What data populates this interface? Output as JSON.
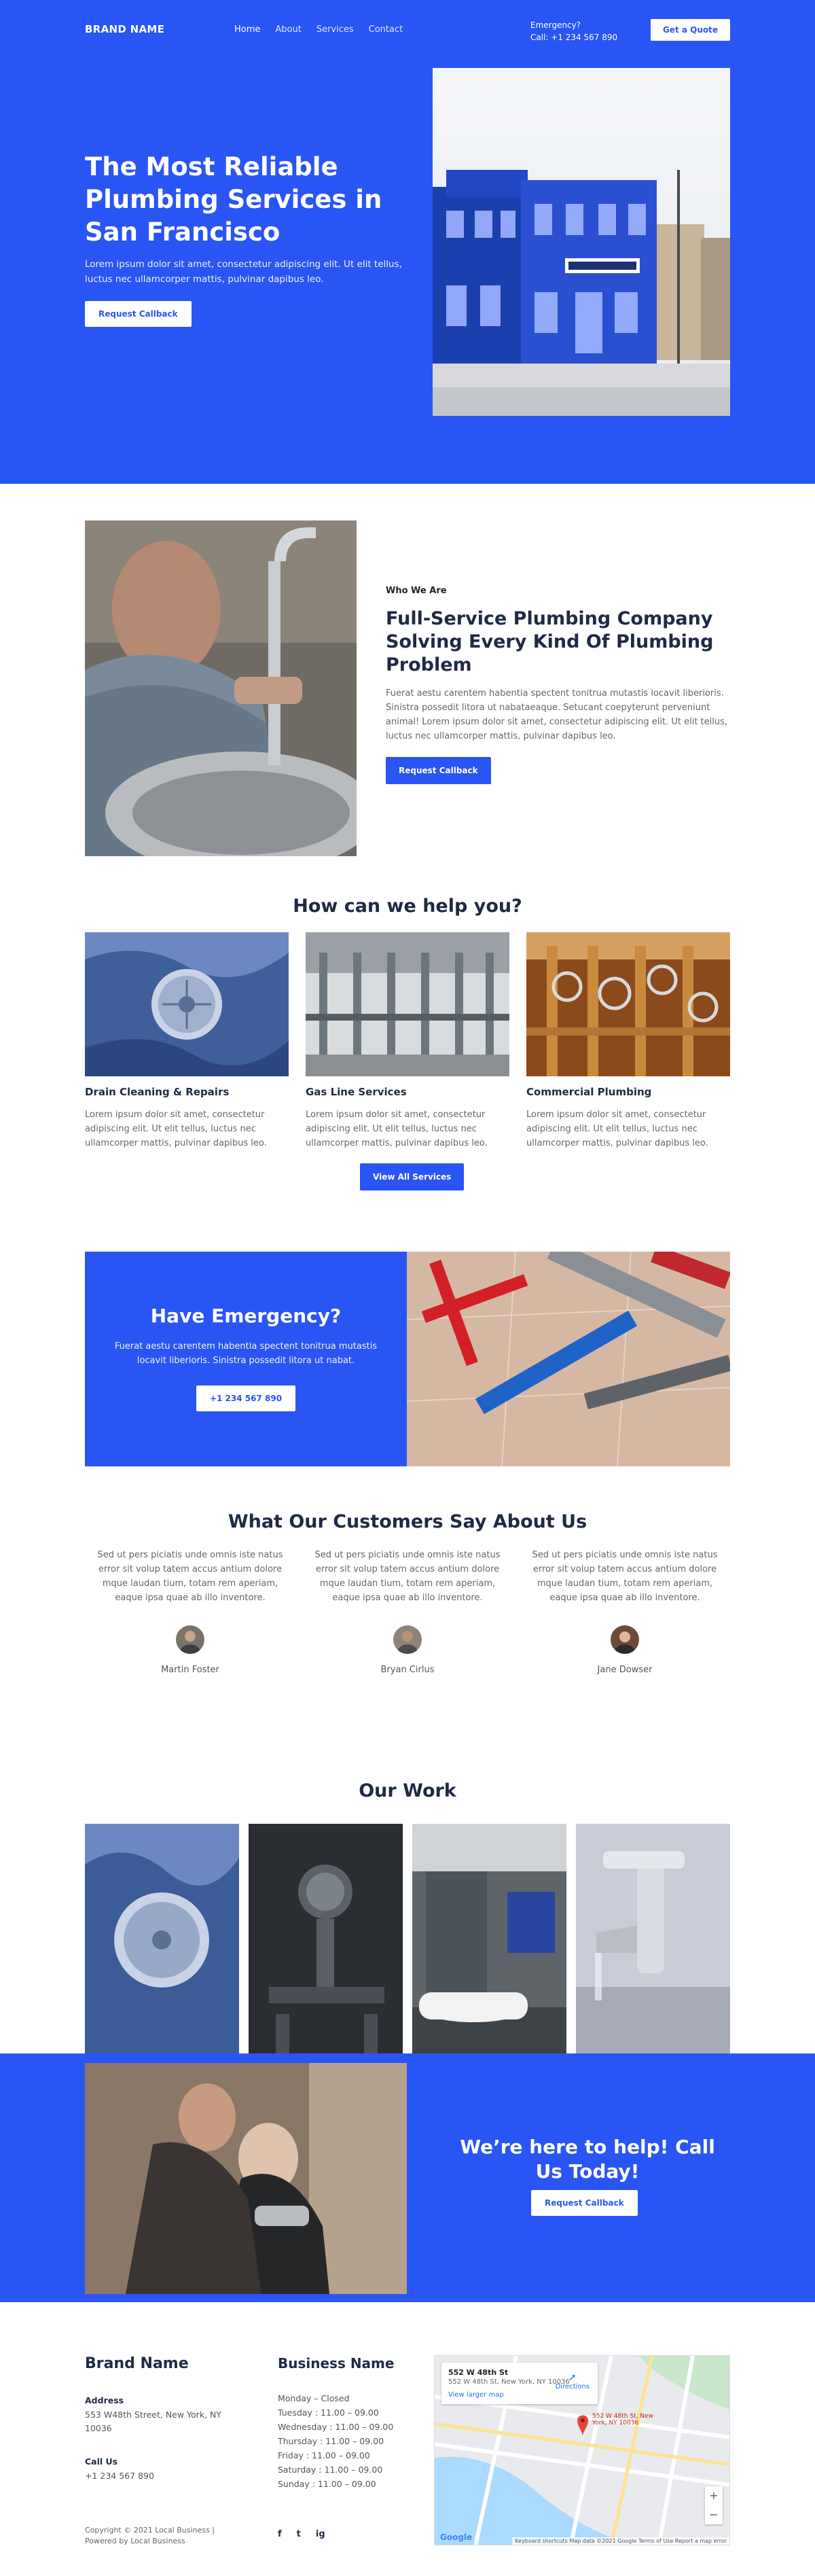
{
  "brand": "BRAND NAME",
  "nav": {
    "items": [
      "Home",
      "About",
      "Services",
      "Contact"
    ]
  },
  "header": {
    "emergency_label": "Emergency?",
    "emergency_phone": "Call: +1 234 567 890",
    "quote_button": "Get a Quote"
  },
  "hero": {
    "title": "The Most Reliable Plumbing Services in San Francisco",
    "text": "Lorem ipsum dolor sit amet, consectetur adipiscing elit. Ut elit tellus, luctus nec ullamcorper mattis, pulvinar dapibus leo.",
    "button": "Request Callback"
  },
  "who": {
    "eyebrow": "Who We Are",
    "title": "Full-Service Plumbing Company Solving Every Kind Of Plumbing Problem",
    "text": "Fuerat aestu carentem habentia spectent tonitrua mutastis locavit liberioris. Sinistra possedit litora ut nabataeaque. Setucant coepyterunt perveniunt animal! Lorem ipsum dolor sit amet, consectetur adipiscing elit. Ut elit tellus, luctus nec ullamcorper mattis, pulvinar dapibus leo.",
    "button": "Request Callback"
  },
  "services": {
    "title": "How can we help you?",
    "items": [
      {
        "title": "Drain Cleaning & Repairs",
        "text": "Lorem ipsum dolor sit amet, consectetur adipiscing elit. Ut elit tellus, luctus nec ullamcorper mattis, pulvinar dapibus leo."
      },
      {
        "title": "Gas Line Services",
        "text": "Lorem ipsum dolor sit amet, consectetur adipiscing elit. Ut elit tellus, luctus nec ullamcorper mattis, pulvinar dapibus leo."
      },
      {
        "title": "Commercial Plumbing",
        "text": "Lorem ipsum dolor sit amet, consectetur adipiscing elit. Ut elit tellus, luctus nec ullamcorper mattis, pulvinar dapibus leo."
      }
    ],
    "button": "View All Services"
  },
  "emergency": {
    "title": "Have Emergency?",
    "text": "Fuerat aestu carentem habentia spectent tonitrua mutastis locavit liberioris. Sinistra possedit litora ut nabat.",
    "button": "+1 234 567 890"
  },
  "testimonials": {
    "title": "What Our Customers Say About Us",
    "items": [
      {
        "text": "Sed ut pers piciatis unde omnis iste natus error sit volup tatem accus antium dolore mque laudan tium, totam rem aperiam, eaque ipsa quae ab illo inventore.",
        "name": "Martin Foster"
      },
      {
        "text": "Sed ut pers piciatis unde omnis iste natus error sit volup tatem accus antium dolore mque laudan tium, totam rem aperiam, eaque ipsa quae ab illo inventore.",
        "name": "Bryan Cirlus"
      },
      {
        "text": "Sed ut pers piciatis unde omnis iste natus error sit volup tatem accus antium dolore mque laudan tium, totam rem aperiam, eaque ipsa quae ab illo inventore.",
        "name": "Jane Dowser"
      }
    ]
  },
  "work": {
    "title": "Our Work"
  },
  "cta": {
    "title": "We’re here to help! Call Us Today!",
    "button": "Request Callback"
  },
  "footer": {
    "brand": "Brand Name",
    "address_label": "Address",
    "address": "553 W48th Street, New York, NY 10036",
    "call_label": "Call Us",
    "phone": "+1 234 567 890",
    "copyright": "Copyright © 2021 Local Business | Powered by Local Business",
    "business_title": "Business Name",
    "hours": [
      "Monday – Closed",
      "Tuesday : 11.00 – 09.00",
      "Wednesday : 11.00 – 09.00",
      "Thursday : 11.00 – 09.00",
      "Friday : 11.00 – 09.00",
      "Saturday : 11.00 – 09.00",
      "Sunday : 11.00 – 09.00"
    ],
    "socials": [
      "f",
      "t",
      "ig"
    ]
  },
  "map": {
    "title": "552 W 48th St",
    "address": "552 W 48th St, New York, NY 10036",
    "larger_link": "View larger map",
    "directions": "Directions",
    "pin_label": "552 W 48th St, New York, NY 10036",
    "credit": "Keyboard shortcuts  Map data ©2021 Google  Terms of Use  Report a map error",
    "logo": "Google"
  }
}
